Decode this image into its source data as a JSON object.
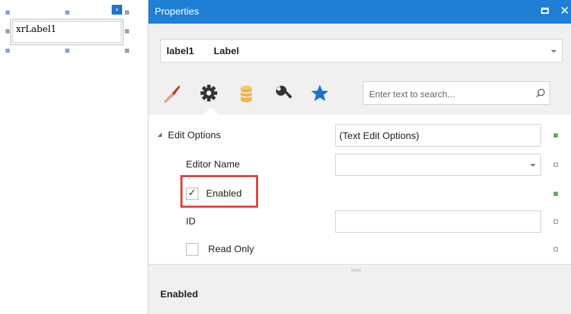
{
  "design_surface": {
    "label_text": "xrLabel1",
    "smart_tag_icon": "chevron-right-icon",
    "smart_tag_glyph": "›"
  },
  "properties_panel": {
    "title": "Properties",
    "window_buttons": [
      "maximize-icon",
      "close-icon"
    ],
    "close_glyph": "✕",
    "object_selector": {
      "name": "label1",
      "type": "Label"
    },
    "tabs": [
      {
        "icon": "brush-icon",
        "active": false
      },
      {
        "icon": "gear-icon",
        "active": true
      },
      {
        "icon": "database-icon",
        "active": false
      },
      {
        "icon": "wrench-icon",
        "active": false
      },
      {
        "icon": "star-icon",
        "active": false
      }
    ],
    "search": {
      "placeholder": "Enter text to search...",
      "value": "",
      "icon": "search-icon"
    },
    "property_grid": {
      "category": {
        "label": "Edit Options",
        "value": "(Text Edit Options)",
        "expanded": true,
        "expand_glyph": "◢"
      },
      "rows": [
        {
          "label": "Editor Name",
          "value": "",
          "type": "dropdown",
          "modified": false
        },
        {
          "label": "Enabled",
          "checked": true,
          "type": "checkbox",
          "modified": true,
          "highlighted": true,
          "check_glyph": "✓"
        },
        {
          "label": "ID",
          "value": "",
          "type": "text",
          "modified": false
        },
        {
          "label": "Read Only",
          "checked": false,
          "type": "checkbox",
          "modified": false
        }
      ]
    },
    "description": {
      "title": "Enabled"
    }
  },
  "colors": {
    "title_bar": "#1e7fd6",
    "modified_marker": "#6aaa6a",
    "highlight_box": "#e0413f",
    "star": "#1e6fd0",
    "brush_handle": "#d8a878",
    "brush_tip": "#c0392b",
    "database": "#f0b34a"
  }
}
